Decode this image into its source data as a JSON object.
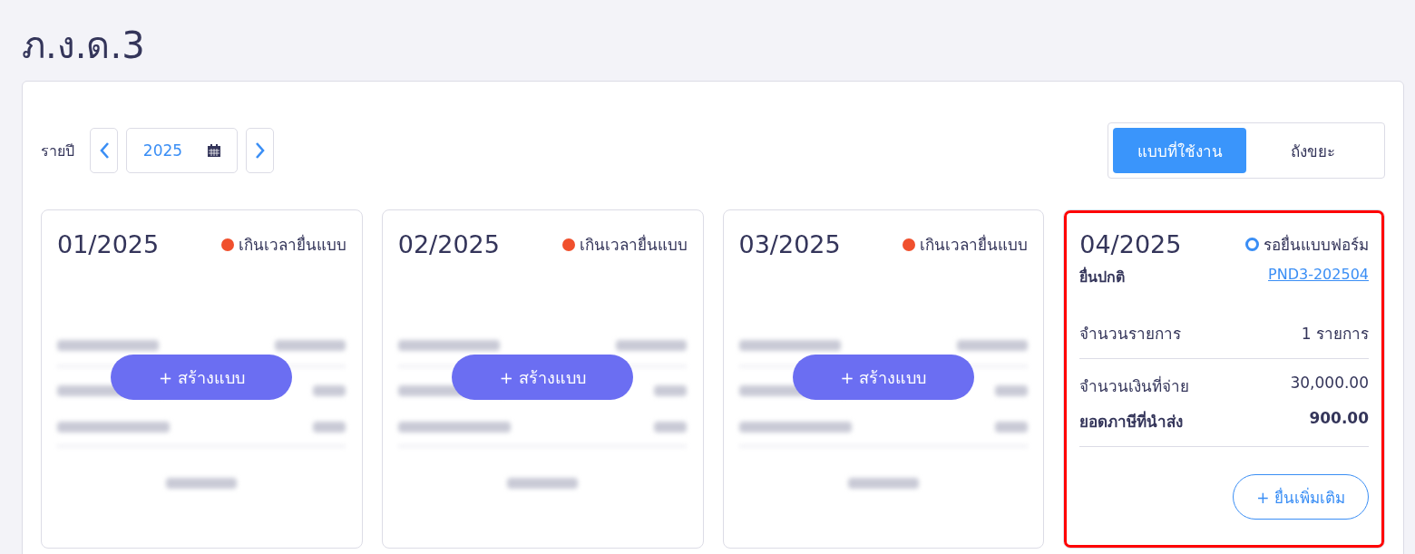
{
  "title": "ภ.ง.ด.3",
  "toolbar": {
    "period_label": "รายปี",
    "year": "2025",
    "tabs": [
      {
        "label": "แบบที่ใช้งาน",
        "selected": true
      },
      {
        "label": "ถังขยะ",
        "selected": false
      }
    ]
  },
  "cards": [
    {
      "kind": "empty",
      "period": "01/2025",
      "status": {
        "kind": "overdue",
        "label": "เกินเวลายื่นแบบ",
        "color": "#f0502d"
      },
      "action": "+ สร้างแบบ",
      "highlighted": false
    },
    {
      "kind": "empty",
      "period": "02/2025",
      "status": {
        "kind": "overdue",
        "label": "เกินเวลายื่นแบบ",
        "color": "#f0502d"
      },
      "action": "+ สร้างแบบ",
      "highlighted": false
    },
    {
      "kind": "empty",
      "period": "03/2025",
      "status": {
        "kind": "overdue",
        "label": "เกินเวลายื่นแบบ",
        "color": "#f0502d"
      },
      "action": "+ สร้างแบบ",
      "highlighted": false
    },
    {
      "kind": "filed",
      "period": "04/2025",
      "status": {
        "kind": "pending",
        "label": "รอยื่นแบบฟอร์ม",
        "color": "#3a8ef5"
      },
      "filing_type": "ยื่นปกติ",
      "reference": "PND3-202504",
      "sections": [
        {
          "rows": [
            {
              "label": "จำนวนรายการ",
              "value": "1 รายการ",
              "bold": false
            }
          ]
        },
        {
          "rows": [
            {
              "label": "จำนวนเงินที่จ่าย",
              "value": "30,000.00",
              "bold": false
            },
            {
              "label": "ยอดภาษีที่นำส่ง",
              "value": "900.00",
              "bold": true
            }
          ]
        }
      ],
      "action": "+ ยื่นเพิ่มเติม",
      "highlighted": true
    }
  ]
}
